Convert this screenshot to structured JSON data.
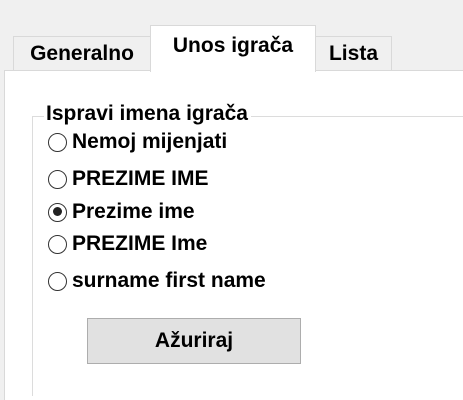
{
  "tabs": [
    {
      "label": "Generalno",
      "active": false
    },
    {
      "label": "Unos igrača",
      "active": true
    },
    {
      "label": "Lista",
      "active": false
    }
  ],
  "group": {
    "title": "Ispravi imena igrača",
    "options": [
      {
        "label": "Nemoj mijenjati",
        "selected": false
      },
      {
        "label": "PREZIME IME",
        "selected": false
      },
      {
        "label": "Prezime ime",
        "selected": true
      },
      {
        "label": "PREZIME Ime",
        "selected": false
      },
      {
        "label": "surname first name",
        "selected": false
      }
    ]
  },
  "update_button": {
    "label": "Ažuriraj"
  }
}
